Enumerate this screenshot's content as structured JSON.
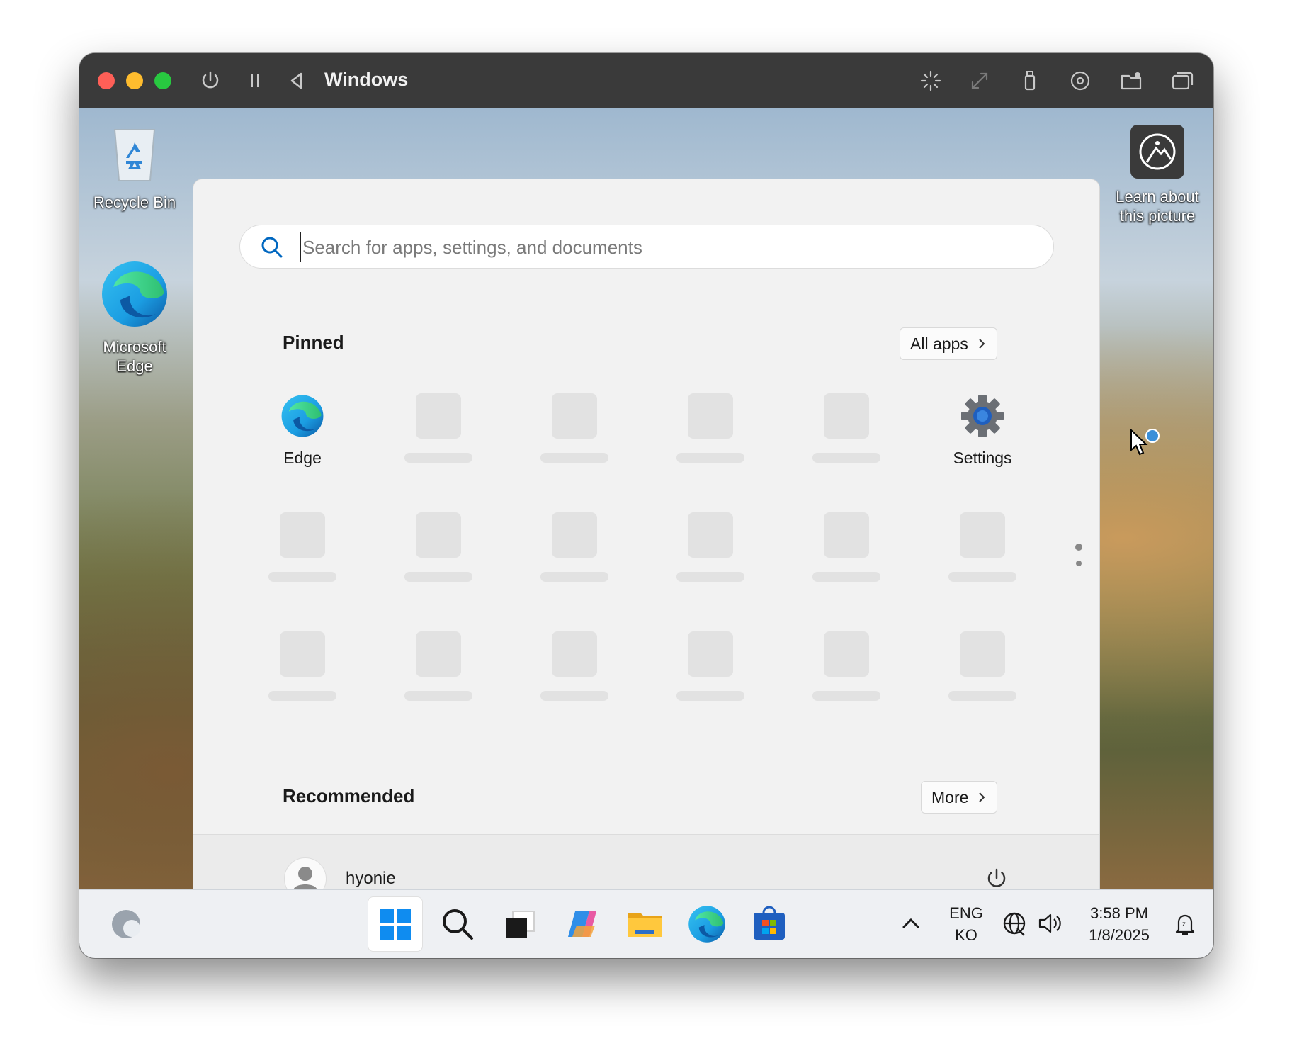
{
  "window": {
    "title": "Windows"
  },
  "desktop": {
    "icons": [
      {
        "label": "Recycle Bin",
        "icon": "recycle-bin-icon"
      },
      {
        "label": "Microsoft Edge",
        "icon": "edge-icon"
      },
      {
        "label": "Learn about this picture",
        "icon": "learn-picture-icon"
      }
    ]
  },
  "start_menu": {
    "search": {
      "placeholder": "Search for apps, settings, and documents",
      "value": ""
    },
    "pinned": {
      "title": "Pinned",
      "all_apps_label": "All apps",
      "apps": [
        {
          "label": "Edge",
          "icon": "edge-icon"
        },
        {
          "label": "Settings",
          "icon": "settings-gear-icon"
        }
      ]
    },
    "recommended": {
      "title": "Recommended",
      "more_label": "More"
    },
    "user": {
      "name": "hyonie"
    }
  },
  "taskbar": {
    "lang_line1": "ENG",
    "lang_line2": "KO",
    "time": "3:58 PM",
    "date": "1/8/2025",
    "apps": [
      "start-icon",
      "search-icon",
      "task-view-icon",
      "copilot-icon",
      "file-explorer-icon",
      "edge-icon",
      "store-icon"
    ]
  },
  "colors": {
    "accent": "#0067c0",
    "titlebar": "#3a3a3a",
    "start_bg": "#f2f2f2"
  }
}
